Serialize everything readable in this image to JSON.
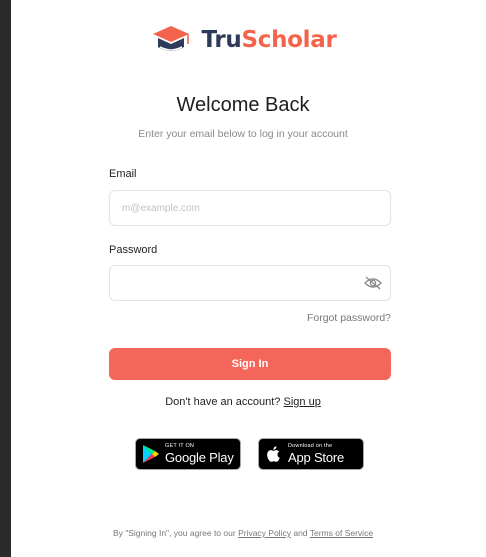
{
  "brand": {
    "name_part1": "Tru",
    "name_part2": "Scholar",
    "colors": {
      "navy": "#2e3a59",
      "coral": "#f4644c",
      "button": "#f5665a"
    }
  },
  "header": {
    "title": "Welcome Back",
    "subtitle": "Enter your email below to log in your account"
  },
  "form": {
    "email": {
      "label": "Email",
      "placeholder": "m@example.com",
      "value": ""
    },
    "password": {
      "label": "Password",
      "placeholder": "",
      "value": "",
      "toggle_icon": "eye-off-icon"
    },
    "forgot_label": "Forgot password?",
    "signin_label": "Sign In"
  },
  "signup": {
    "prompt": "Don't have an account?",
    "link_label": "Sign up"
  },
  "stores": {
    "google_play": {
      "small": "GET IT ON",
      "big": "Google Play"
    },
    "app_store": {
      "small": "Download on the",
      "big": "App Store"
    }
  },
  "legal": {
    "prefix": "By \"Signing In\", you agree to our",
    "privacy": "Privacy Policy",
    "and": "and",
    "terms": "Terms of Service"
  }
}
